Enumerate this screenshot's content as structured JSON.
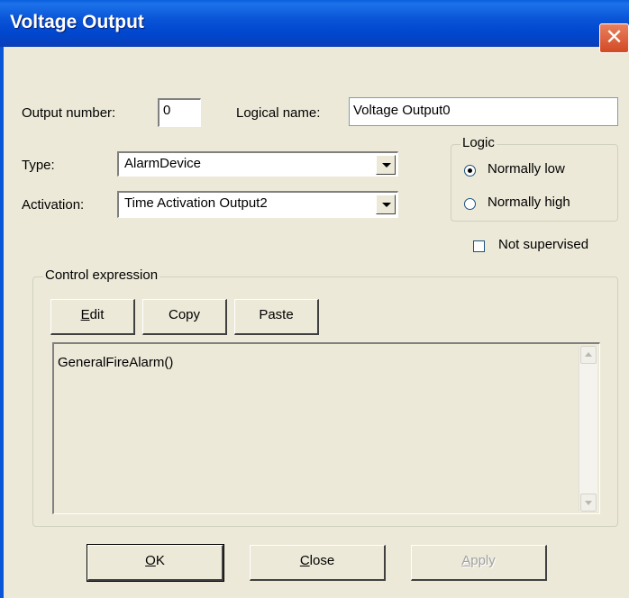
{
  "window": {
    "title": "Voltage Output",
    "close_glyph": "✕"
  },
  "output_number": {
    "label": "Output number:",
    "value": "0"
  },
  "logical_name": {
    "label": "Logical name:",
    "value": "Voltage Output0"
  },
  "type": {
    "label": "Type:",
    "value": "AlarmDevice"
  },
  "activation": {
    "label": "Activation:",
    "value": "Time Activation Output2"
  },
  "logic": {
    "legend": "Logic",
    "options": [
      {
        "label": "Normally low",
        "checked": true
      },
      {
        "label": "Normally high",
        "checked": false
      }
    ]
  },
  "not_supervised": {
    "label": "Not supervised",
    "checked": false
  },
  "control_expression": {
    "legend": "Control expression",
    "buttons": {
      "edit": {
        "accel": "E",
        "rest": "dit"
      },
      "copy": "Copy",
      "paste": "Paste"
    },
    "text": "GeneralFireAlarm()"
  },
  "footer": {
    "ok": {
      "accel": "O",
      "rest": "K"
    },
    "close": {
      "accel": "C",
      "rest": "lose"
    },
    "apply": {
      "accel": "A",
      "rest": "pply",
      "enabled": false
    }
  },
  "icons": {
    "close": "close-icon",
    "dropdown": "chevron-down-icon",
    "scroll_up": "scroll-up-icon",
    "scroll_down": "scroll-down-icon"
  },
  "colors": {
    "titlebar": "#0a55d8",
    "dialog_bg": "#ece9d8",
    "close_button": "#d24a23"
  }
}
